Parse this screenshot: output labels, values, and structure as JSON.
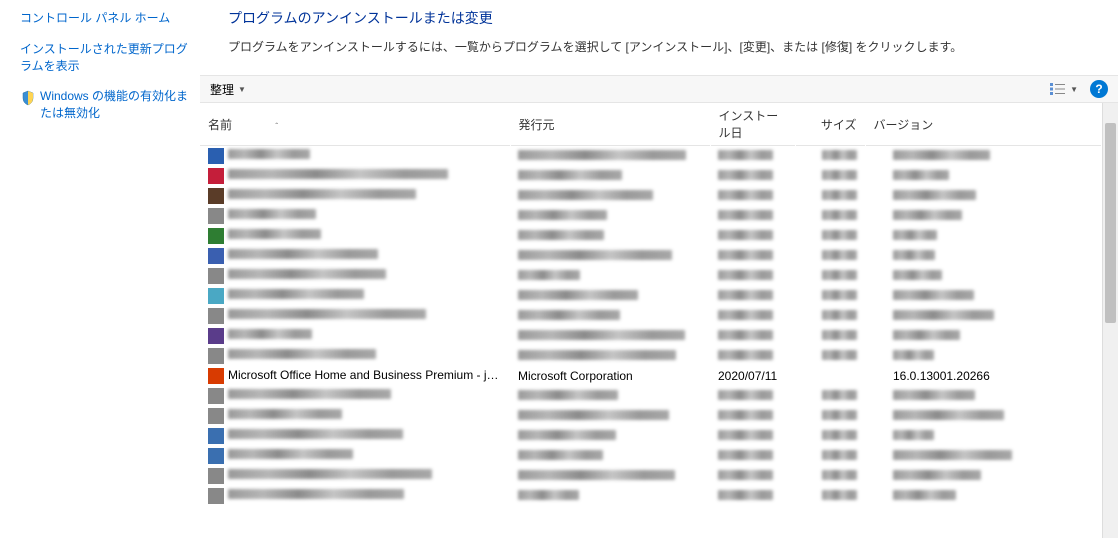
{
  "sidebar": {
    "home": "コントロール パネル ホーム",
    "updates": "インストールされた更新プログラムを表示",
    "features": "Windows の機能の有効化または無効化"
  },
  "main": {
    "heading": "プログラムのアンインストールまたは変更",
    "subtext": "プログラムをアンインストールするには、一覧からプログラムを選択して [アンインストール]、[変更]、または [修復] をクリックします。"
  },
  "toolbar": {
    "organize": "整理",
    "help": "?"
  },
  "columns": {
    "name": "名前",
    "publisher": "発行元",
    "date": "インストール日",
    "size": "サイズ",
    "version": "バージョン"
  },
  "rows": [
    {
      "icon": "#2a5fb0",
      "blur": true
    },
    {
      "icon": "#c41e3a",
      "blur": true
    },
    {
      "icon": "#5a3c28",
      "blur": true
    },
    {
      "icon": "#888",
      "blur": true
    },
    {
      "icon": "#2e7d32",
      "blur": true
    },
    {
      "icon": "#3a5fb0",
      "blur": true
    },
    {
      "icon": "#888",
      "blur": true
    },
    {
      "icon": "#4aa8c4",
      "blur": true
    },
    {
      "icon": "#888",
      "blur": true
    },
    {
      "icon": "#5a3c8a",
      "blur": true
    },
    {
      "icon": "#888",
      "blur": true
    },
    {
      "icon": "#d83b01",
      "blur": false,
      "name": "Microsoft Office Home and Business Premium - ja-jp",
      "publisher": "Microsoft Corporation",
      "date": "2020/07/11",
      "size": "",
      "version": "16.0.13001.20266"
    },
    {
      "icon": "#888",
      "blur": true
    },
    {
      "icon": "#888",
      "blur": true
    },
    {
      "icon": "#3a6fb0",
      "blur": true
    },
    {
      "icon": "#3a6fb0",
      "blur": true
    },
    {
      "icon": "#888",
      "blur": true
    },
    {
      "icon": "#888",
      "blur": true
    }
  ]
}
